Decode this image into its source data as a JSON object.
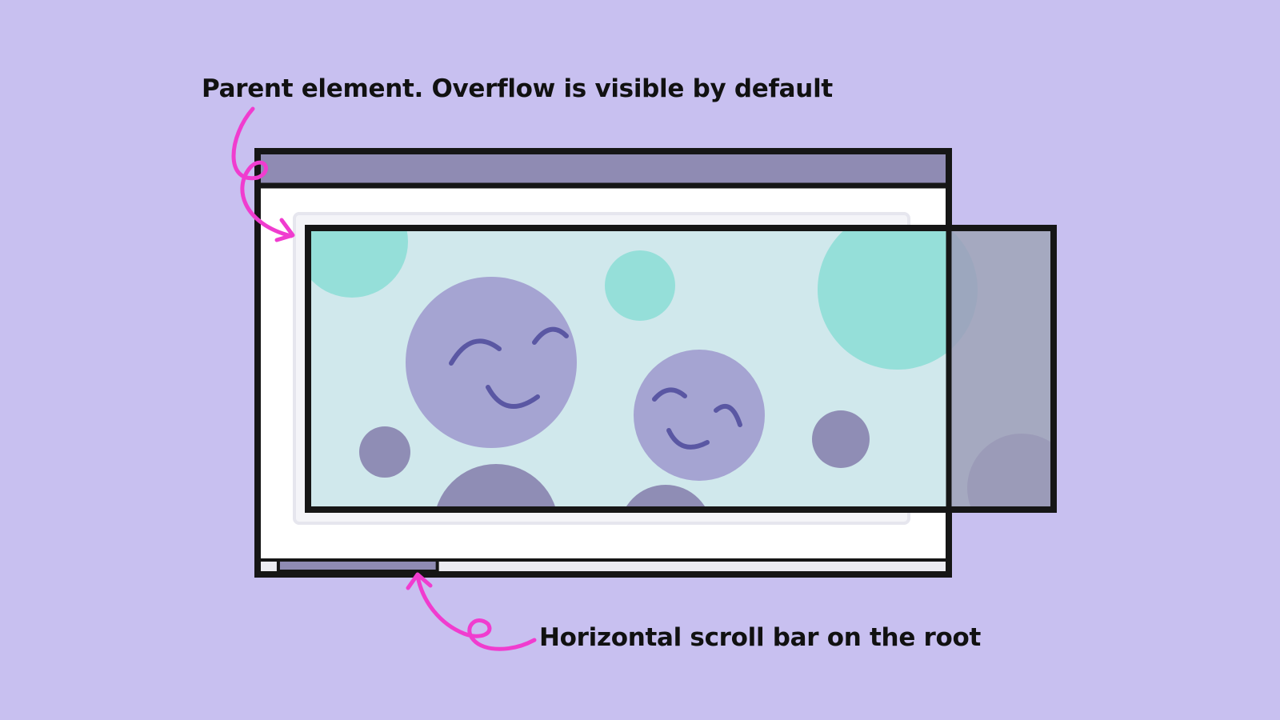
{
  "annotations": {
    "parent_element": "Parent element. Overflow is visible by default",
    "scroll_bar": "Horizontal scroll bar on the root"
  },
  "colors": {
    "background": "#c8c0f0",
    "window_titlebar": "#8f8bb3",
    "window_body": "#ffffff",
    "child_panel": "#d0e8ec",
    "teal_circle": "#95dfd9",
    "face_circle": "#a5a4d2",
    "dark_circle": "#8f8db5",
    "face_stroke": "#5a57a3",
    "overflow_shade": "#9e9eb8",
    "outline": "#161616",
    "arrow": "#f03ccf",
    "scroll_thumb": "#8f8bb3",
    "scroll_track": "#ececf2"
  },
  "scrollbar": {
    "thumb_position_fraction": 0.03,
    "thumb_size_fraction": 0.23
  }
}
